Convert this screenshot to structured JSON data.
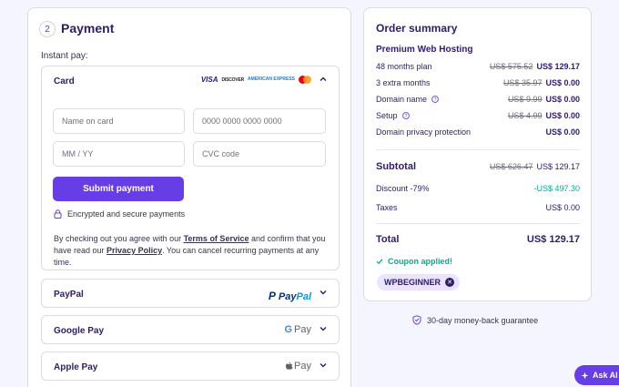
{
  "payment": {
    "step_number": "2",
    "title": "Payment",
    "instant_pay_label": "Instant pay:",
    "card": {
      "label": "Card",
      "logos": [
        "VISA",
        "DISCOVER",
        "AMERICAN EXPRESS",
        "mastercard"
      ],
      "name_placeholder": "Name on card",
      "number_placeholder": "0000 0000 0000 0000",
      "expiry_placeholder": "MM / YY",
      "cvc_placeholder": "CVC code",
      "submit_label": "Submit payment",
      "secure_text": "Encrypted and secure payments",
      "terms_prefix": "By checking out you agree with our ",
      "terms_link": "Terms of Service",
      "terms_middle": " and confirm that you have read our ",
      "privacy_link": "Privacy Policy",
      "terms_suffix": ". You can cancel recurring payments at any time."
    },
    "paypal": {
      "label": "PayPal",
      "logo_a": "Pay",
      "logo_b": "Pal"
    },
    "googlepay": {
      "label": "Google Pay",
      "logo_g": "G",
      "logo_text": "Pay"
    },
    "applepay": {
      "label": "Apple Pay",
      "logo_text": "Pay"
    }
  },
  "summary": {
    "title": "Order summary",
    "product": "Premium Web Hosting",
    "lines": [
      {
        "label": "48 months plan",
        "old": "US$ 575.52",
        "new": "US$ 129.17"
      },
      {
        "label": "3 extra months",
        "old": "US$ 35.97",
        "new": "US$ 0.00"
      },
      {
        "label": "Domain name",
        "old": "US$ 9.99",
        "new": "US$ 0.00"
      },
      {
        "label": "Setup",
        "old": "US$ 4.99",
        "new": "US$ 0.00"
      },
      {
        "label": "Domain privacy protection",
        "new": "US$ 0.00"
      }
    ],
    "subtotal": {
      "label": "Subtotal",
      "old": "US$ 626.47",
      "new": "US$ 129.17"
    },
    "discount": {
      "label": "Discount -79%",
      "value": "-US$ 497.30"
    },
    "taxes": {
      "label": "Taxes",
      "value": "US$ 0.00"
    },
    "total": {
      "label": "Total",
      "value": "US$ 129.17"
    },
    "coupon_applied": "Coupon applied!",
    "coupon_code": "WPBEGINNER"
  },
  "guarantee": "30-day money-back guarantee",
  "ask_ai": "Ask AI",
  "colors": {
    "accent": "#673de6",
    "success": "#00b090",
    "text": "#2f1c6a"
  }
}
